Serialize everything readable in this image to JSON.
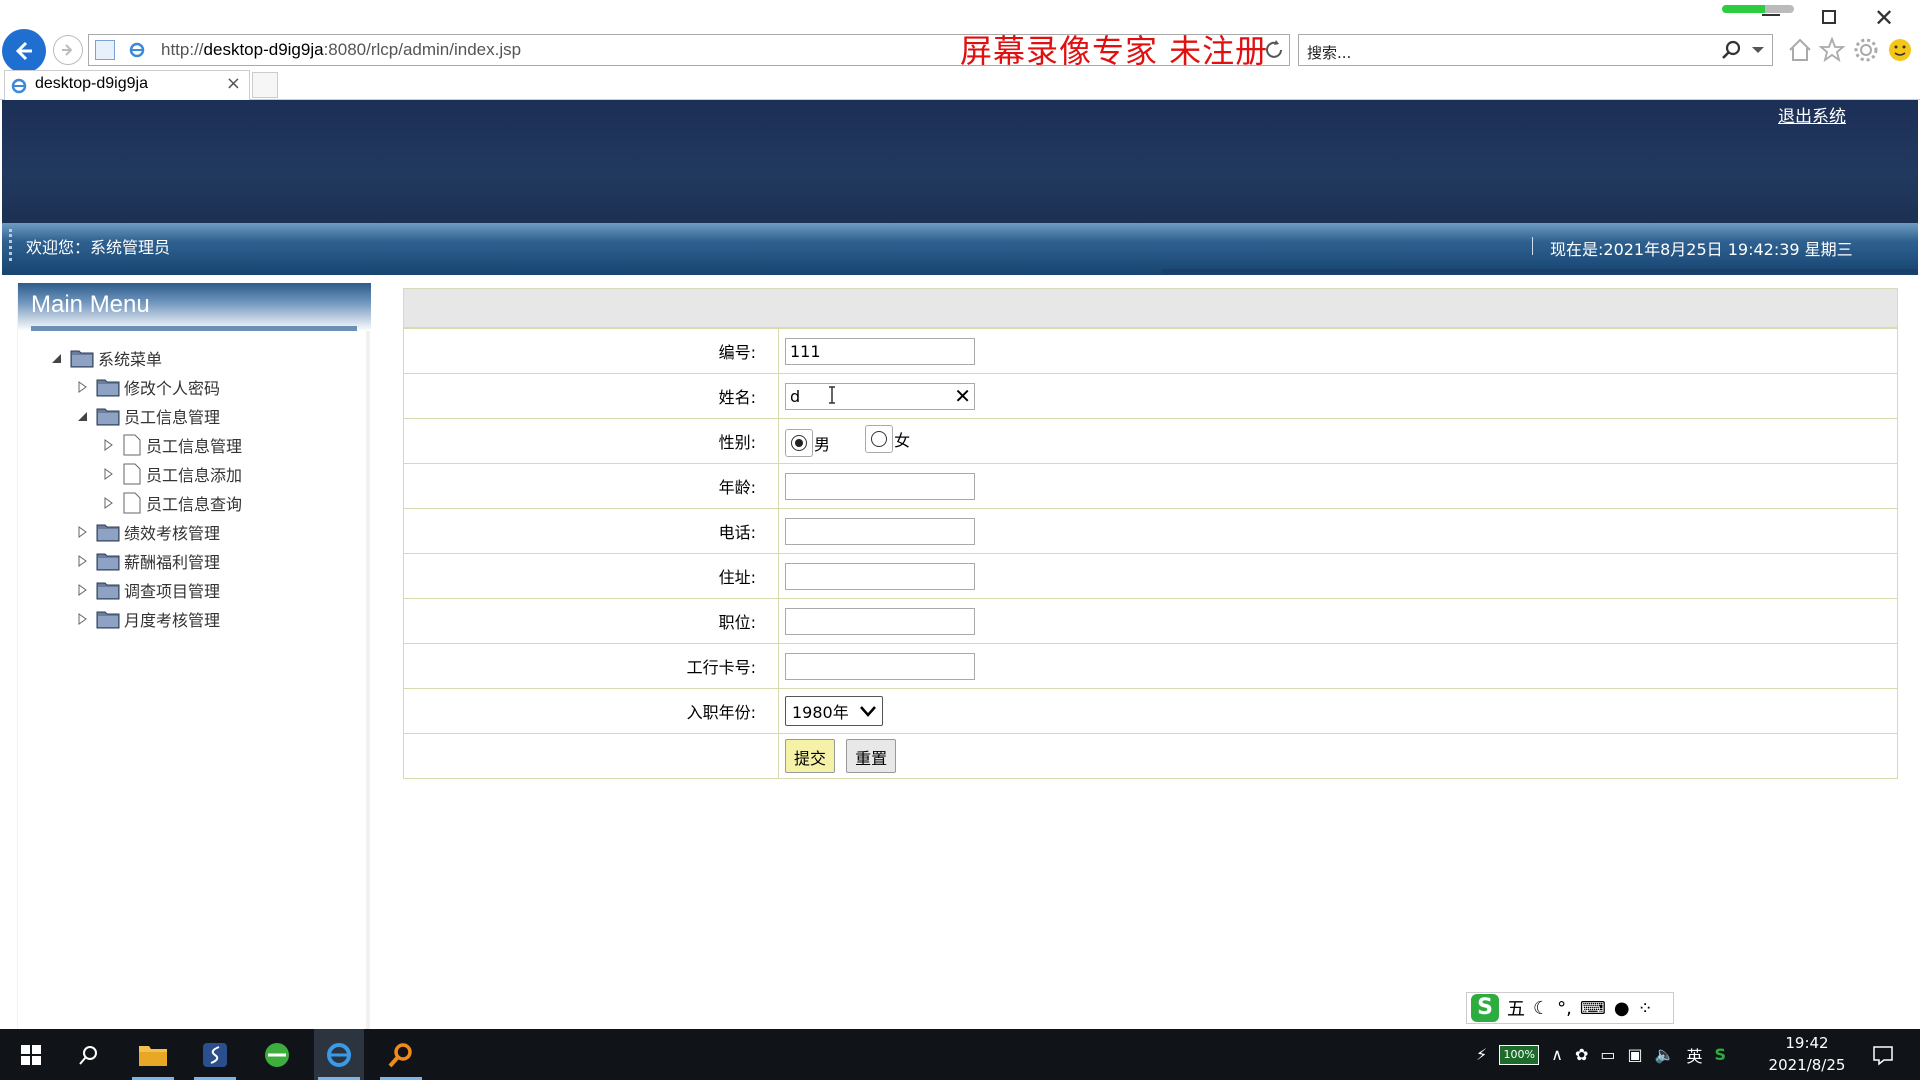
{
  "browser": {
    "url_prefix": "http://",
    "url_host": "desktop-d9ig9ja",
    "url_rest": ":8080/rlcp/admin/index.jsp",
    "watermark": "屏幕录像专家  未注册",
    "search_placeholder": "搜索...",
    "tab_title": "desktop-d9ig9ja"
  },
  "header": {
    "logout": "退出系统",
    "welcome": "欢迎您：系统管理员",
    "clock": "现在是:2021年8月25日  19:42:39 星期三"
  },
  "sidebar": {
    "title": "Main Menu",
    "items": [
      {
        "label": "系统菜单"
      },
      {
        "label": "修改个人密码"
      },
      {
        "label": "员工信息管理"
      },
      {
        "label": "员工信息管理"
      },
      {
        "label": "员工信息添加"
      },
      {
        "label": "员工信息查询"
      },
      {
        "label": "绩效考核管理"
      },
      {
        "label": "薪酬福利管理"
      },
      {
        "label": "调查项目管理"
      },
      {
        "label": "月度考核管理"
      }
    ]
  },
  "form": {
    "id_label": "编号:",
    "id_value": "111",
    "name_label": "姓名:",
    "name_value": "d",
    "gender_label": "性别:",
    "gender_male": "男",
    "gender_female": "女",
    "age_label": "年龄:",
    "phone_label": "电话:",
    "address_label": "住址:",
    "position_label": "职位:",
    "bank_label": "工行卡号:",
    "year_label": "入职年份:",
    "year_value": "1980年",
    "submit": "提交",
    "reset": "重置"
  },
  "ime": {
    "logo": "S",
    "mode": "五"
  },
  "taskbar": {
    "battery": "100%",
    "lang": "英",
    "time": "19:42",
    "date": "2021/8/25"
  },
  "colors": {
    "header_bg": "#1c2f57",
    "infobar_bg": "#2f6190",
    "submit_bg": "#f5f2a8",
    "watermark": "#e01010"
  }
}
